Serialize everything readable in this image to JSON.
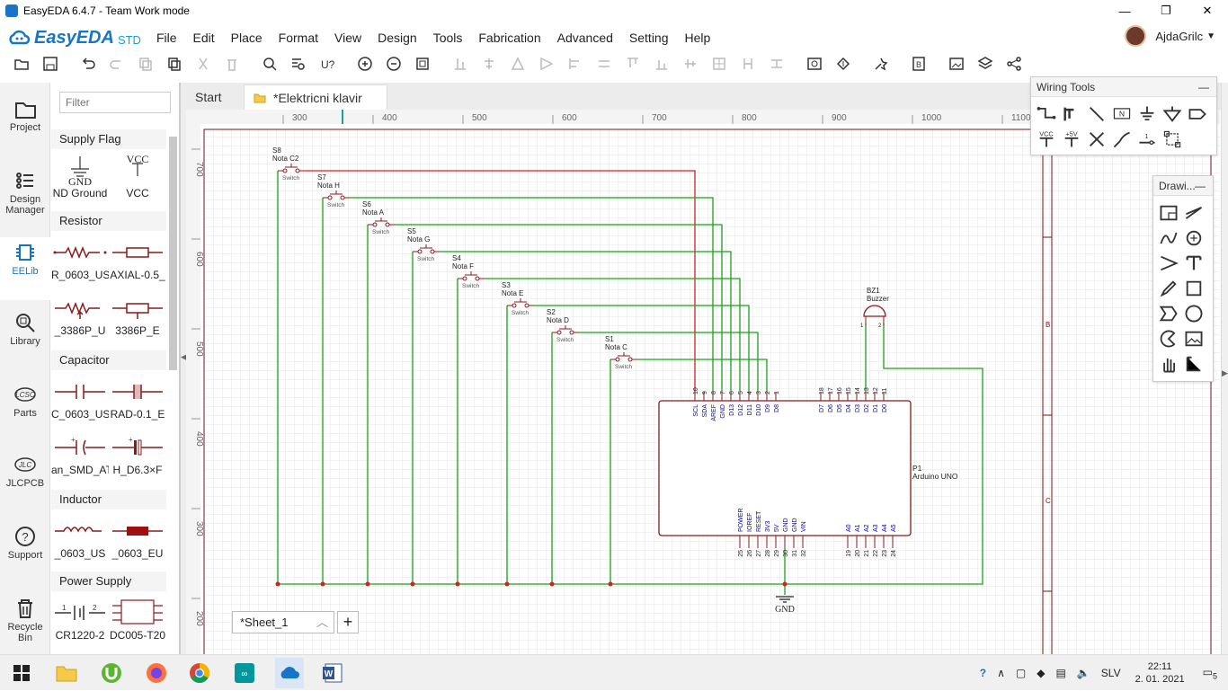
{
  "window": {
    "title": "EasyEDA 6.4.7 - Team Work mode",
    "min": "—",
    "max": "❐",
    "close": "✕"
  },
  "brand": {
    "name": "EasyEDA",
    "edition": "STD"
  },
  "menu": [
    "File",
    "Edit",
    "Place",
    "Format",
    "View",
    "Design",
    "Tools",
    "Fabrication",
    "Advanced",
    "Setting",
    "Help"
  ],
  "user": {
    "name": "AjdaGrilc"
  },
  "leftnav": [
    {
      "label": "Project",
      "icon": "folder-icon"
    },
    {
      "label": "Design\nManager",
      "icon": "list-icon"
    },
    {
      "label": "EELib",
      "icon": "chip-icon"
    },
    {
      "label": "Library",
      "icon": "library-icon"
    },
    {
      "label": "Parts",
      "icon": "lcsc-icon"
    },
    {
      "label": "JLCPCB",
      "icon": "jlc-icon"
    },
    {
      "label": "Support",
      "icon": "help-icon"
    },
    {
      "label": "Recycle\nBin",
      "icon": "trash-icon"
    }
  ],
  "library": {
    "filter_placeholder": "Filter",
    "categories": [
      {
        "name": "Supply Flag",
        "parts": [
          "ND Ground",
          "VCC"
        ]
      },
      {
        "name": "Resistor",
        "parts": [
          "R_0603_US",
          "AXIAL-0.5_",
          "_3386P_U",
          "3386P_E"
        ]
      },
      {
        "name": "Capacitor",
        "parts": [
          "C_0603_US",
          "RAD-0.1_E",
          "an_SMD_AT",
          "H_D6.3×F"
        ]
      },
      {
        "name": "Inductor",
        "parts": [
          "_0603_US",
          "_0603_EU"
        ]
      },
      {
        "name": "Power Supply",
        "parts": [
          "CR1220-2",
          "DC005-T20"
        ]
      }
    ],
    "symbol_text": {
      "gnd": "GND",
      "vcc": "VCC"
    }
  },
  "tabs": [
    {
      "label": "Start",
      "active": false
    },
    {
      "label": "*Elektricni klavir",
      "active": true
    }
  ],
  "ruler": {
    "h": [
      "300",
      "400",
      "500",
      "600",
      "700",
      "800",
      "900",
      "1000",
      "1100"
    ],
    "v": [
      "700",
      "600",
      "500",
      "400",
      "300",
      "200"
    ]
  },
  "sheet": {
    "label": "*Sheet_1",
    "add": "+"
  },
  "wiring_tools": {
    "title": "Wiring Tools",
    "minimize": "—"
  },
  "drawing_tools": {
    "title": "Drawi...",
    "minimize": "—"
  },
  "frame_labels": [
    "B",
    "C"
  ],
  "schematic": {
    "switches": [
      {
        "ref": "S8",
        "note": "Nota C2",
        "type": "Switch"
      },
      {
        "ref": "S7",
        "note": "Nota H",
        "type": "Switch"
      },
      {
        "ref": "S6",
        "note": "Nota A",
        "type": "Switch"
      },
      {
        "ref": "S5",
        "note": "Nota G",
        "type": "Switch"
      },
      {
        "ref": "S4",
        "note": "Nota F",
        "type": "Switch"
      },
      {
        "ref": "S3",
        "note": "Nota E",
        "type": "Switch"
      },
      {
        "ref": "S2",
        "note": "Nota D",
        "type": "Switch"
      },
      {
        "ref": "S1",
        "note": "Nota C",
        "type": "Switch"
      }
    ],
    "buzzer": {
      "ref": "BZ1",
      "name": "Buzzer"
    },
    "arduino": {
      "ref": "P1",
      "name": "Arduino UNO",
      "top_pins_left": [
        {
          "num": "10",
          "name": "SCL"
        },
        {
          "num": "9",
          "name": "SDA"
        },
        {
          "num": "8",
          "name": "AREF"
        },
        {
          "num": "7",
          "name": "GND"
        },
        {
          "num": "6",
          "name": "D13"
        },
        {
          "num": "5",
          "name": "D12"
        },
        {
          "num": "4",
          "name": "D11"
        },
        {
          "num": "3",
          "name": "D10"
        },
        {
          "num": "2",
          "name": "D9"
        },
        {
          "num": "1",
          "name": "D8"
        }
      ],
      "top_pins_right": [
        {
          "num": "18",
          "name": "D7"
        },
        {
          "num": "17",
          "name": "D6"
        },
        {
          "num": "16",
          "name": "D5"
        },
        {
          "num": "15",
          "name": "D4"
        },
        {
          "num": "14",
          "name": "D3"
        },
        {
          "num": "13",
          "name": "D2"
        },
        {
          "num": "12",
          "name": "D1"
        },
        {
          "num": "11",
          "name": "D0"
        }
      ],
      "bottom_pins_left": [
        {
          "num": "25",
          "name": "POWER"
        },
        {
          "num": "26",
          "name": "IOREF"
        },
        {
          "num": "27",
          "name": "RESET"
        },
        {
          "num": "28",
          "name": "3V3"
        },
        {
          "num": "29",
          "name": "5V"
        },
        {
          "num": "30",
          "name": "GND"
        },
        {
          "num": "31",
          "name": "GND"
        },
        {
          "num": "32",
          "name": "VIN"
        }
      ],
      "bottom_pins_right": [
        {
          "num": "19",
          "name": "A0"
        },
        {
          "num": "20",
          "name": "A1"
        },
        {
          "num": "21",
          "name": "A2"
        },
        {
          "num": "22",
          "name": "A3"
        },
        {
          "num": "23",
          "name": "A4"
        },
        {
          "num": "24",
          "name": "A5"
        }
      ]
    },
    "gnd_label": "GND",
    "colors": {
      "wire": "#1aa01a",
      "wire_red": "#d42020",
      "part": "#8b1a1a",
      "pin_text": "#0000c0"
    }
  },
  "taskbar": {
    "lang": "SLV",
    "time": "22:11",
    "date": "2. 01. 2021",
    "notification_count": "5"
  }
}
